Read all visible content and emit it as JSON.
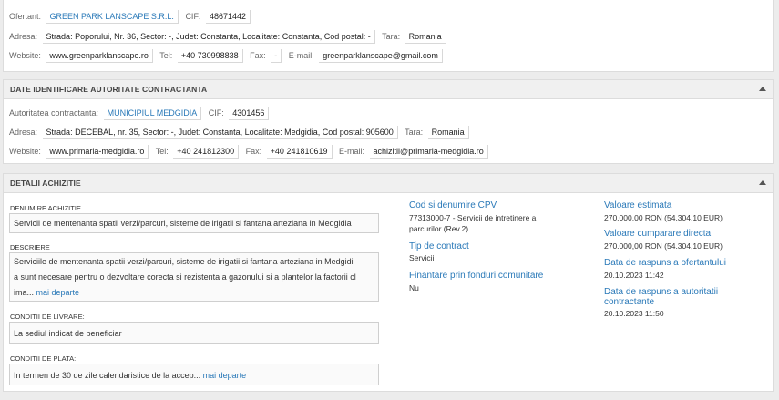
{
  "ofertant": {
    "label": "Ofertant:",
    "name": "GREEN PARK LANSCAPE S.R.L.",
    "cif_label": "CIF:",
    "cif": "48671442",
    "adresa_label": "Adresa:",
    "adresa": "Strada: Poporului, Nr. 36, Sector: -, Judet: Constanta, Localitate: Constanta, Cod postal: -",
    "tara_label": "Tara:",
    "tara": "Romania",
    "website_label": "Website:",
    "website": "www.greenparklanscape.ro",
    "tel_label": "Tel:",
    "tel": "+40 730998838",
    "fax_label": "Fax:",
    "fax": "-",
    "email_label": "E-mail:",
    "email": "greenparklanscape@gmail.com"
  },
  "autoritate": {
    "section_title": "DATE IDENTIFICARE AUTORITATE CONTRACTANTA",
    "label": "Autoritatea contractanta:",
    "name": "MUNICIPIUL MEDGIDIA",
    "cif_label": "CIF:",
    "cif": "4301456",
    "adresa_label": "Adresa:",
    "adresa": "Strada: DECEBAL, nr. 35, Sector: -, Judet: Constanta, Localitate: Medgidia, Cod postal: 905600",
    "tara_label": "Tara:",
    "tara": "Romania",
    "website_label": "Website:",
    "website": "www.primaria-medgidia.ro",
    "tel_label": "Tel:",
    "tel": "+40 241812300",
    "fax_label": "Fax:",
    "fax": "+40 241810619",
    "email_label": "E-mail:",
    "email": "achizitii@primaria-medgidia.ro"
  },
  "achizitie": {
    "section_title": "DETALII ACHIZITIE",
    "denumire_label": "DENUMIRE ACHIZITIE",
    "denumire": "Servicii de mentenanta spatii verzi/parcuri, sisteme de irigatii si fantana arteziana in Medgidia",
    "descriere_label": "DESCRIERE",
    "descriere": "Serviciile de mentenanta spatii verzi/parcuri, sisteme de irigatii si fantana arteziana in Medgidia sunt necesare pentru o dezvoltare corecta si rezistenta a gazonului si a plantelor la factorii climа...",
    "descriere_l1": "Serviciile de mentenanta spatii verzi/parcuri, sisteme de irigatii si fantana arteziana in Medgidi",
    "descriere_l2": "a sunt necesare pentru o dezvoltare corecta si rezistenta a gazonului si a plantelor la factorii cl",
    "descriere_l3": "ima...",
    "more_label": "mai departe",
    "livrare_label": "CONDITII DE LIVRARE:",
    "livrare": "La sediul indicat de beneficiar",
    "plata_label": "CONDITII DE PLATA:",
    "plata": "In termen de 30 de zile calendaristice de la accep...",
    "cpv_title": "Cod si denumire CPV",
    "cpv_l1": "77313000-7 - Servicii de intretinere a",
    "cpv_l2": "parcurilor (Rev.2)",
    "tip_title": "Tip de contract",
    "tip": "Servicii",
    "fonduri_title": "Finantare prin fonduri comunitare",
    "fonduri": "Nu",
    "estimata_title": "Valoare estimata",
    "estimata": "270.000,00 RON (54.304,10 EUR)",
    "cumparare_title": "Valoare cumparare directa",
    "cumparare": "270.000,00 RON (54.304,10 EUR)",
    "raspuns_ofertant_title": "Data de raspuns a ofertantului",
    "raspuns_ofertant": "20.10.2023 11:42",
    "raspuns_autoritate_l1": "Data de raspuns a autoritatii",
    "raspuns_autoritate_l2": "contractante",
    "raspuns_autoritate": "20.10.2023 11:50"
  }
}
